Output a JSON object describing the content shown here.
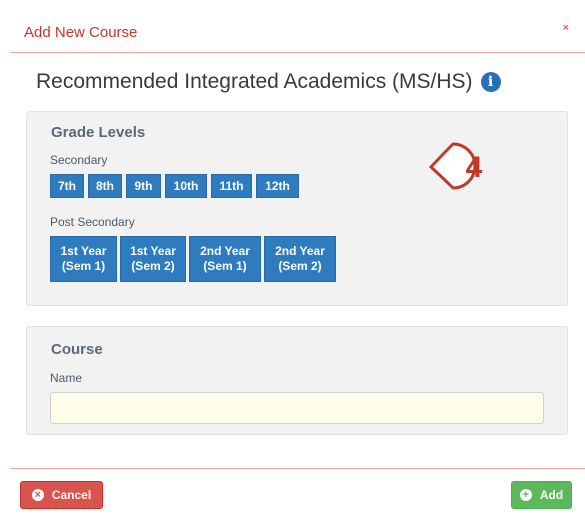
{
  "modal": {
    "title": "Add New Course",
    "close_glyph": "×"
  },
  "page_title": "Recommended Integrated Academics (MS/HS)",
  "info_icon": "info-icon",
  "grade_levels": {
    "heading": "Grade Levels",
    "secondary_label": "Secondary",
    "secondary": [
      "7th",
      "8th",
      "9th",
      "10th",
      "11th",
      "12th"
    ],
    "post_secondary_label": "Post Secondary",
    "post_secondary": [
      "1st Year\n(Sem 1)",
      "1st Year\n(Sem 2)",
      "2nd Year\n(Sem 1)",
      "2nd Year\n(Sem 2)"
    ]
  },
  "callout": {
    "number": "4",
    "color": "#c0392b"
  },
  "course": {
    "heading": "Course",
    "name_label": "Name",
    "name_value": ""
  },
  "footer": {
    "cancel_label": "Cancel",
    "cancel_icon": "times-circle-icon",
    "add_label": "Add",
    "add_icon": "plus-circle-icon"
  },
  "colors": {
    "primary": "#2e7bbd",
    "danger": "#d9534f",
    "success": "#5cb85c"
  }
}
